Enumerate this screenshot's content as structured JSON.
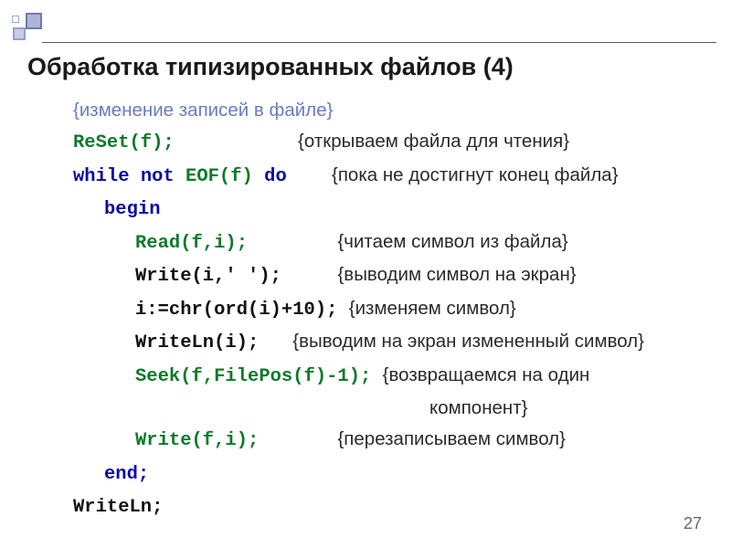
{
  "title": "Обработка типизированных файлов (4)",
  "intro_comment": "{изменение записей в файле}",
  "lines": {
    "reset_code": "ReSet(f);",
    "reset_spacer": "           ",
    "reset_comment": "{открываем файла для чтения}",
    "while_kw1": "while ",
    "while_not": "not ",
    "while_eof": "EOF(f) ",
    "while_do": "do",
    "while_spacer": "    ",
    "while_comment": "{пока не достигнут конец файла}",
    "begin_kw": "begin",
    "read_code": "Read(f,i);",
    "read_spacer": "        ",
    "read_comment": "{читаем символ из файла}",
    "writei_code": "Write(i,' ');",
    "writei_spacer": "     ",
    "writei_comment": "{выводим символ на экран}",
    "assign_code": "i:=chr(ord(i)+10);",
    "assign_spacer": " ",
    "assign_comment": "{изменяем символ}",
    "writeln_i_code": "WriteLn(i);",
    "writeln_i_spacer": "   ",
    "writeln_i_comment": "{выводим на экран измененный символ}",
    "seek_code": "Seek(f,FilePos(f)-1);",
    "seek_spacer": " ",
    "seek_comment": "{возвращаемся на один",
    "seek_comment2": "компонент}",
    "writefi_code": "Write(f,i);",
    "writefi_spacer": "       ",
    "writefi_comment": "{перезаписываем символ}",
    "end_kw": "end;",
    "writeln_final": "WriteLn;"
  },
  "page_number": "27"
}
